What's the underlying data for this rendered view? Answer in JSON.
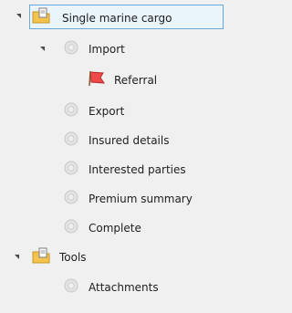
{
  "tree": {
    "root": {
      "label": "Single marine cargo",
      "icon": "folder-document-icon"
    },
    "import": {
      "label": "Import",
      "icon": "gear-icon"
    },
    "referral": {
      "label": "Referral",
      "icon": "red-flag-icon"
    },
    "export": {
      "label": "Export",
      "icon": "gear-icon"
    },
    "insured": {
      "label": "Insured details",
      "icon": "gear-icon"
    },
    "parties": {
      "label": "Interested parties",
      "icon": "gear-icon"
    },
    "premium": {
      "label": "Premium summary",
      "icon": "gear-icon"
    },
    "complete": {
      "label": "Complete",
      "icon": "gear-icon"
    },
    "tools": {
      "label": "Tools",
      "icon": "folder-document-icon"
    },
    "attachments": {
      "label": "Attachments",
      "icon": "gear-icon"
    }
  },
  "colors": {
    "background": "#f0f0f0",
    "selection_border": "#69a8d8",
    "selection_fill": "#eaf4fb",
    "text": "#1e1e1e"
  }
}
